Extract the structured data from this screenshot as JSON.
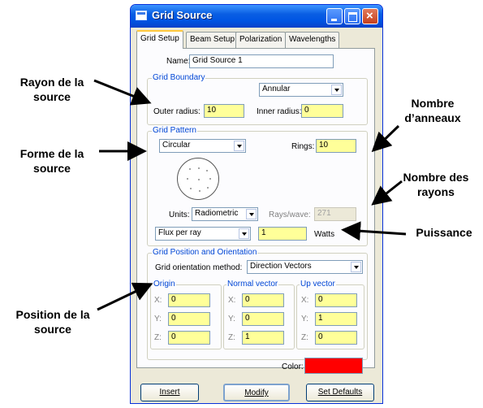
{
  "window": {
    "title": "Grid Source"
  },
  "tabs": [
    {
      "label": "Grid Setup",
      "active": true
    },
    {
      "label": "Beam Setup",
      "active": false
    },
    {
      "label": "Polarization",
      "active": false
    },
    {
      "label": "Wavelengths",
      "active": false
    }
  ],
  "name": {
    "label": "Name:",
    "value": "Grid Source 1"
  },
  "grid_boundary": {
    "title": "Grid Boundary",
    "shape": "Annular",
    "outer_radius_label": "Outer radius:",
    "outer_radius": "10",
    "inner_radius_label": "Inner radius:",
    "inner_radius": "0"
  },
  "grid_pattern": {
    "title": "Grid Pattern",
    "pattern": "Circular",
    "rings_label": "Rings:",
    "rings": "10",
    "units_label": "Units:",
    "units": "Radiometric",
    "rays_wave_label": "Rays/wave:",
    "rays_wave": "271",
    "flux_mode": "Flux per ray",
    "flux_value": "1",
    "flux_unit": "Watts"
  },
  "orientation": {
    "title": "Grid Position and Orientation",
    "method_label": "Grid orientation method:",
    "method": "Direction Vectors",
    "origin": {
      "title": "Origin",
      "x": "0",
      "y": "0",
      "z": "0"
    },
    "normal": {
      "title": "Normal vector",
      "x": "0",
      "y": "0",
      "z": "1"
    },
    "up": {
      "title": "Up vector",
      "x": "0",
      "y": "1",
      "z": "0"
    },
    "axis_labels": {
      "x": "X:",
      "y": "Y:",
      "z": "Z:"
    },
    "color_label": "Color:",
    "color_value": "#ff0000"
  },
  "buttons": {
    "insert": "Insert",
    "modify": "Modify",
    "set_defaults": "Set Defaults"
  },
  "annotations": {
    "rayon": [
      "Rayon de la",
      "source"
    ],
    "forme": [
      "Forme de la",
      "source"
    ],
    "position": [
      "Position de la",
      "source"
    ],
    "nombre_anneaux": [
      "Nombre",
      "d’anneaux"
    ],
    "nombre_rayons": [
      "Nombre des",
      "rayons"
    ],
    "puissance": "Puissance"
  },
  "colors": {
    "titlebar": "#0054e3",
    "field_yellow": "#ffff99",
    "swatch": "#ff0000"
  }
}
